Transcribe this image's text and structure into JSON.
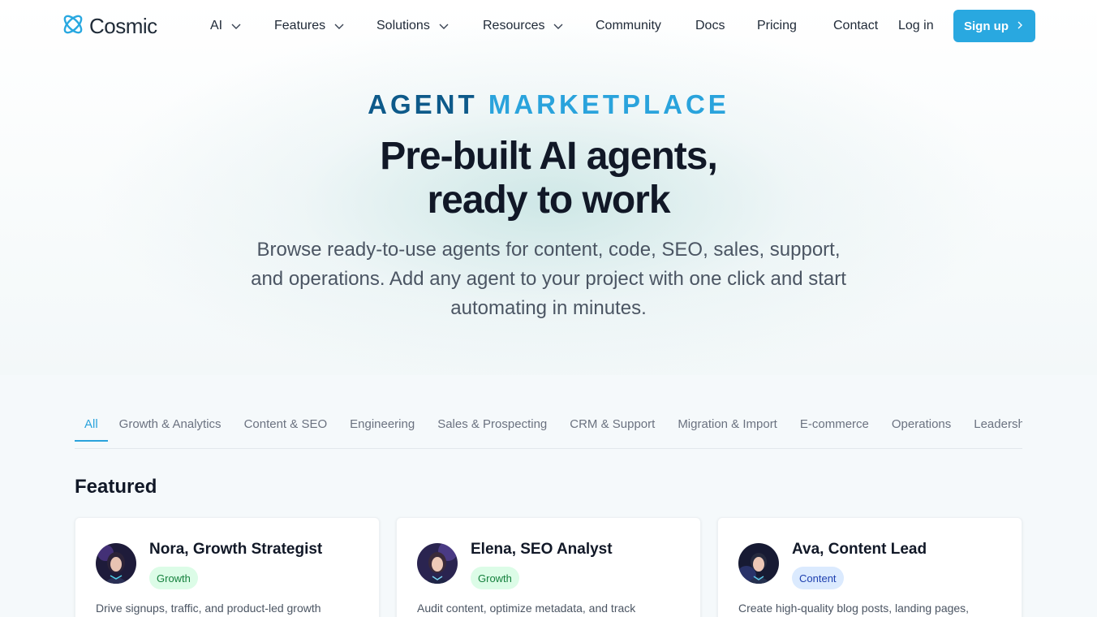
{
  "brand": {
    "name": "Cosmic",
    "accent": "#29a8e0",
    "dark_accent": "#0e5a8a"
  },
  "nav": {
    "items": [
      {
        "label": "AI",
        "has_dropdown": true
      },
      {
        "label": "Features",
        "has_dropdown": true
      },
      {
        "label": "Solutions",
        "has_dropdown": true
      },
      {
        "label": "Resources",
        "has_dropdown": true
      },
      {
        "label": "Community",
        "has_dropdown": false
      },
      {
        "label": "Docs",
        "has_dropdown": false
      },
      {
        "label": "Pricing",
        "has_dropdown": false
      },
      {
        "label": "Contact",
        "has_dropdown": false
      }
    ],
    "login": "Log in",
    "signup": "Sign up"
  },
  "hero": {
    "eyebrow_part1": "AGENT",
    "eyebrow_part2": "MARKETPLACE",
    "title_line1": "Pre-built AI agents,",
    "title_line2": "ready to work",
    "subtitle": "Browse ready-to-use agents for content, code, SEO, sales, support, and operations. Add any agent to your project with one click and start automating in minutes."
  },
  "tabs": [
    {
      "label": "All",
      "active": true
    },
    {
      "label": "Growth & Analytics",
      "active": false
    },
    {
      "label": "Content & SEO",
      "active": false
    },
    {
      "label": "Engineering",
      "active": false
    },
    {
      "label": "Sales & Prospecting",
      "active": false
    },
    {
      "label": "CRM & Support",
      "active": false
    },
    {
      "label": "Migration & Import",
      "active": false
    },
    {
      "label": "E-commerce",
      "active": false
    },
    {
      "label": "Operations",
      "active": false
    },
    {
      "label": "Leadership",
      "active": false
    }
  ],
  "featured": {
    "title": "Featured",
    "cards": [
      {
        "name": "Nora, Growth Strategist",
        "badge": "Growth",
        "badge_color": "green",
        "description": "Drive signups, traffic, and product-led growth"
      },
      {
        "name": "Elena, SEO Analyst",
        "badge": "Growth",
        "badge_color": "green",
        "description": "Audit content, optimize metadata, and track"
      },
      {
        "name": "Ava, Content Lead",
        "badge": "Content",
        "badge_color": "blue",
        "description": "Create high-quality blog posts, landing pages,"
      }
    ]
  }
}
